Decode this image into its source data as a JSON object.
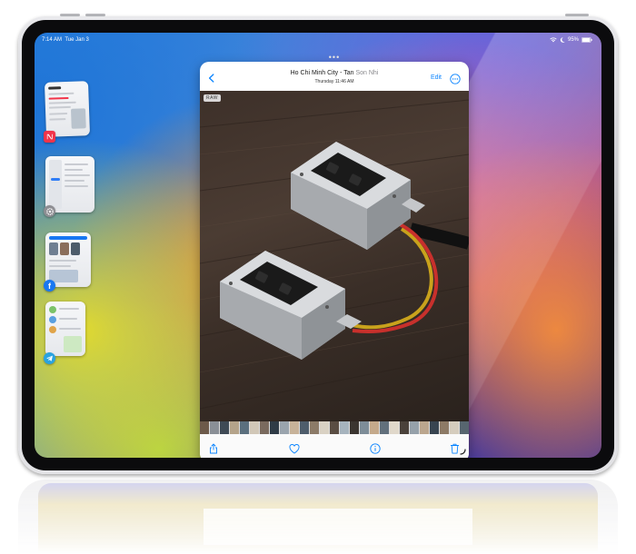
{
  "status_bar": {
    "time": "7:14 AM",
    "date": "Tue Jan 3",
    "battery": "95%",
    "icons": [
      "wifi-icon",
      "moon-icon",
      "battery-icon"
    ]
  },
  "slide_over": {
    "apps": [
      {
        "name": "Apple News",
        "icon": "news-icon",
        "color": "#f2344a"
      },
      {
        "name": "Settings",
        "icon": "settings-icon",
        "color": "#8e8e93"
      },
      {
        "name": "Facebook",
        "icon": "facebook-icon",
        "color": "#1877f2",
        "glyph": "f"
      },
      {
        "name": "Telegram",
        "icon": "telegram-icon",
        "color": "#2aa3df"
      }
    ]
  },
  "photo_viewer": {
    "grabber": "•••",
    "title_main": "Ho Chi Minh City - Tan ",
    "title_faded": "Son Nhi",
    "subtitle": "Thursday  11:46 AM",
    "edit_label": "Edit",
    "raw_badge": "RAW",
    "photo_subject": "two electrical outlet boxes with red and yellow wires on a wooden table",
    "thumbnail_colors": [
      "#6d5a4a",
      "#8a8f96",
      "#3f4a55",
      "#b4a38a",
      "#5b6f7e",
      "#d1c7b7",
      "#7a6a5e",
      "#2f3b46",
      "#9aa4ad",
      "#c7b299",
      "#4e5d6b",
      "#8c7b68",
      "#d9d1c3",
      "#5a4d43",
      "#a6b3bd",
      "#3b3530",
      "#7e8d98",
      "#c4a98b",
      "#62707c",
      "#e0d8ca",
      "#4a413a",
      "#96a1aa",
      "#bba68e",
      "#384450",
      "#8d7a66",
      "#d5ccbd",
      "#57656f",
      "#a49380"
    ],
    "toolbar": [
      "share-icon",
      "heart-icon",
      "info-icon",
      "trash-icon"
    ]
  }
}
